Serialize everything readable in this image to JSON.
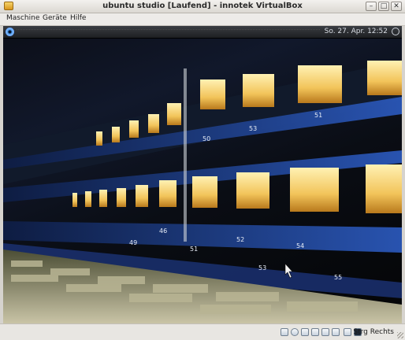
{
  "window": {
    "title": "ubuntu studio [Laufend] - innotek VirtualBox",
    "controls": {
      "minimize": "–",
      "maximize": "□",
      "close": "✕"
    }
  },
  "menu": {
    "items": [
      "Maschine",
      "Geräte",
      "Hilfe"
    ]
  },
  "guest": {
    "clock": "So. 27. Apr. 12:52",
    "wallpaper_scale_labels": [
      "51",
      "53",
      "50",
      "46",
      "52",
      "54",
      "51",
      "53",
      "55",
      "49"
    ]
  },
  "status_bar": {
    "host_key_label": "Strg Rechts",
    "icons": [
      "harddisk-icon",
      "cdrom-icon",
      "floppy-icon",
      "network-icon",
      "usb-icon",
      "shared-folders-icon",
      "mouse-integration-icon",
      "hostkey-icon"
    ]
  },
  "colors": {
    "rack_blue": "#1b3f8f",
    "meter_amber": "#f3c55e",
    "panel_dark": "#1d1f22",
    "window_frame": "#d6d3ce"
  }
}
